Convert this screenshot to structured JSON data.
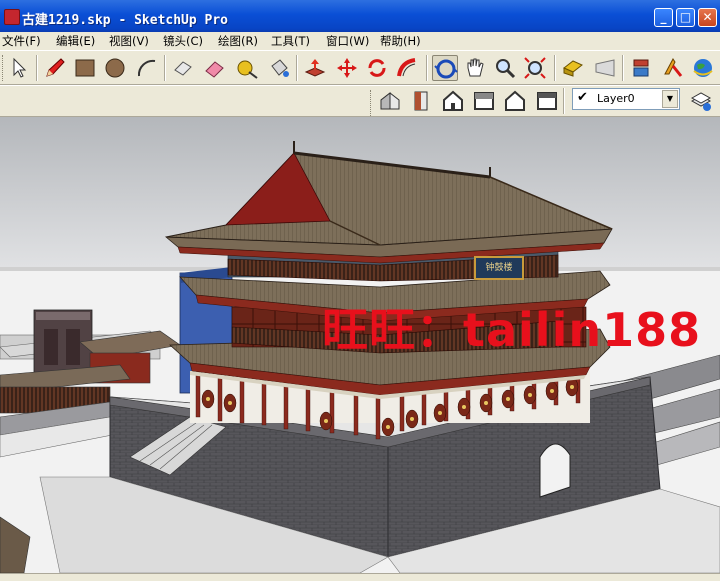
{
  "window": {
    "title": "古建1219.skp - SketchUp Pro",
    "buttons": {
      "minimize": "_",
      "maximize": "□",
      "close": "✕"
    }
  },
  "menu": {
    "items": [
      "文件(F)",
      "编辑(E)",
      "视图(V)",
      "镜头(C)",
      "绘图(R)",
      "工具(T)",
      "窗口(W)",
      "帮助(H)"
    ]
  },
  "toolbar_main": {
    "tools": [
      "select-icon",
      "pencil-icon",
      "rectangle-icon",
      "circle-icon",
      "arc-icon",
      "eraser-box-icon",
      "eraser-icon",
      "tape-measure-icon",
      "paint-bucket-icon",
      "push-pull-icon",
      "move-icon",
      "rotate-icon",
      "follow-me-icon",
      "orbit-icon",
      "pan-icon",
      "zoom-icon",
      "zoom-extents-icon",
      "previous-view-icon",
      "next-view-icon",
      "components-icon",
      "add-location-icon",
      "google-earth-icon"
    ]
  },
  "toolbar_views": {
    "views": [
      "iso-view-icon",
      "top-view-icon",
      "front-view-icon",
      "right-view-icon",
      "back-view-icon",
      "left-view-icon"
    ]
  },
  "layers": {
    "current": "Layer0",
    "check": "✔"
  },
  "model": {
    "watermark": "旺旺：tailin188",
    "signboard": "钟鼓楼"
  },
  "colors": {
    "title_bar": "#0a4fd6",
    "watermark": "#e8101c",
    "roof": "#7a6a55",
    "wall": "#56555a",
    "timber": "#8b2a1e"
  }
}
